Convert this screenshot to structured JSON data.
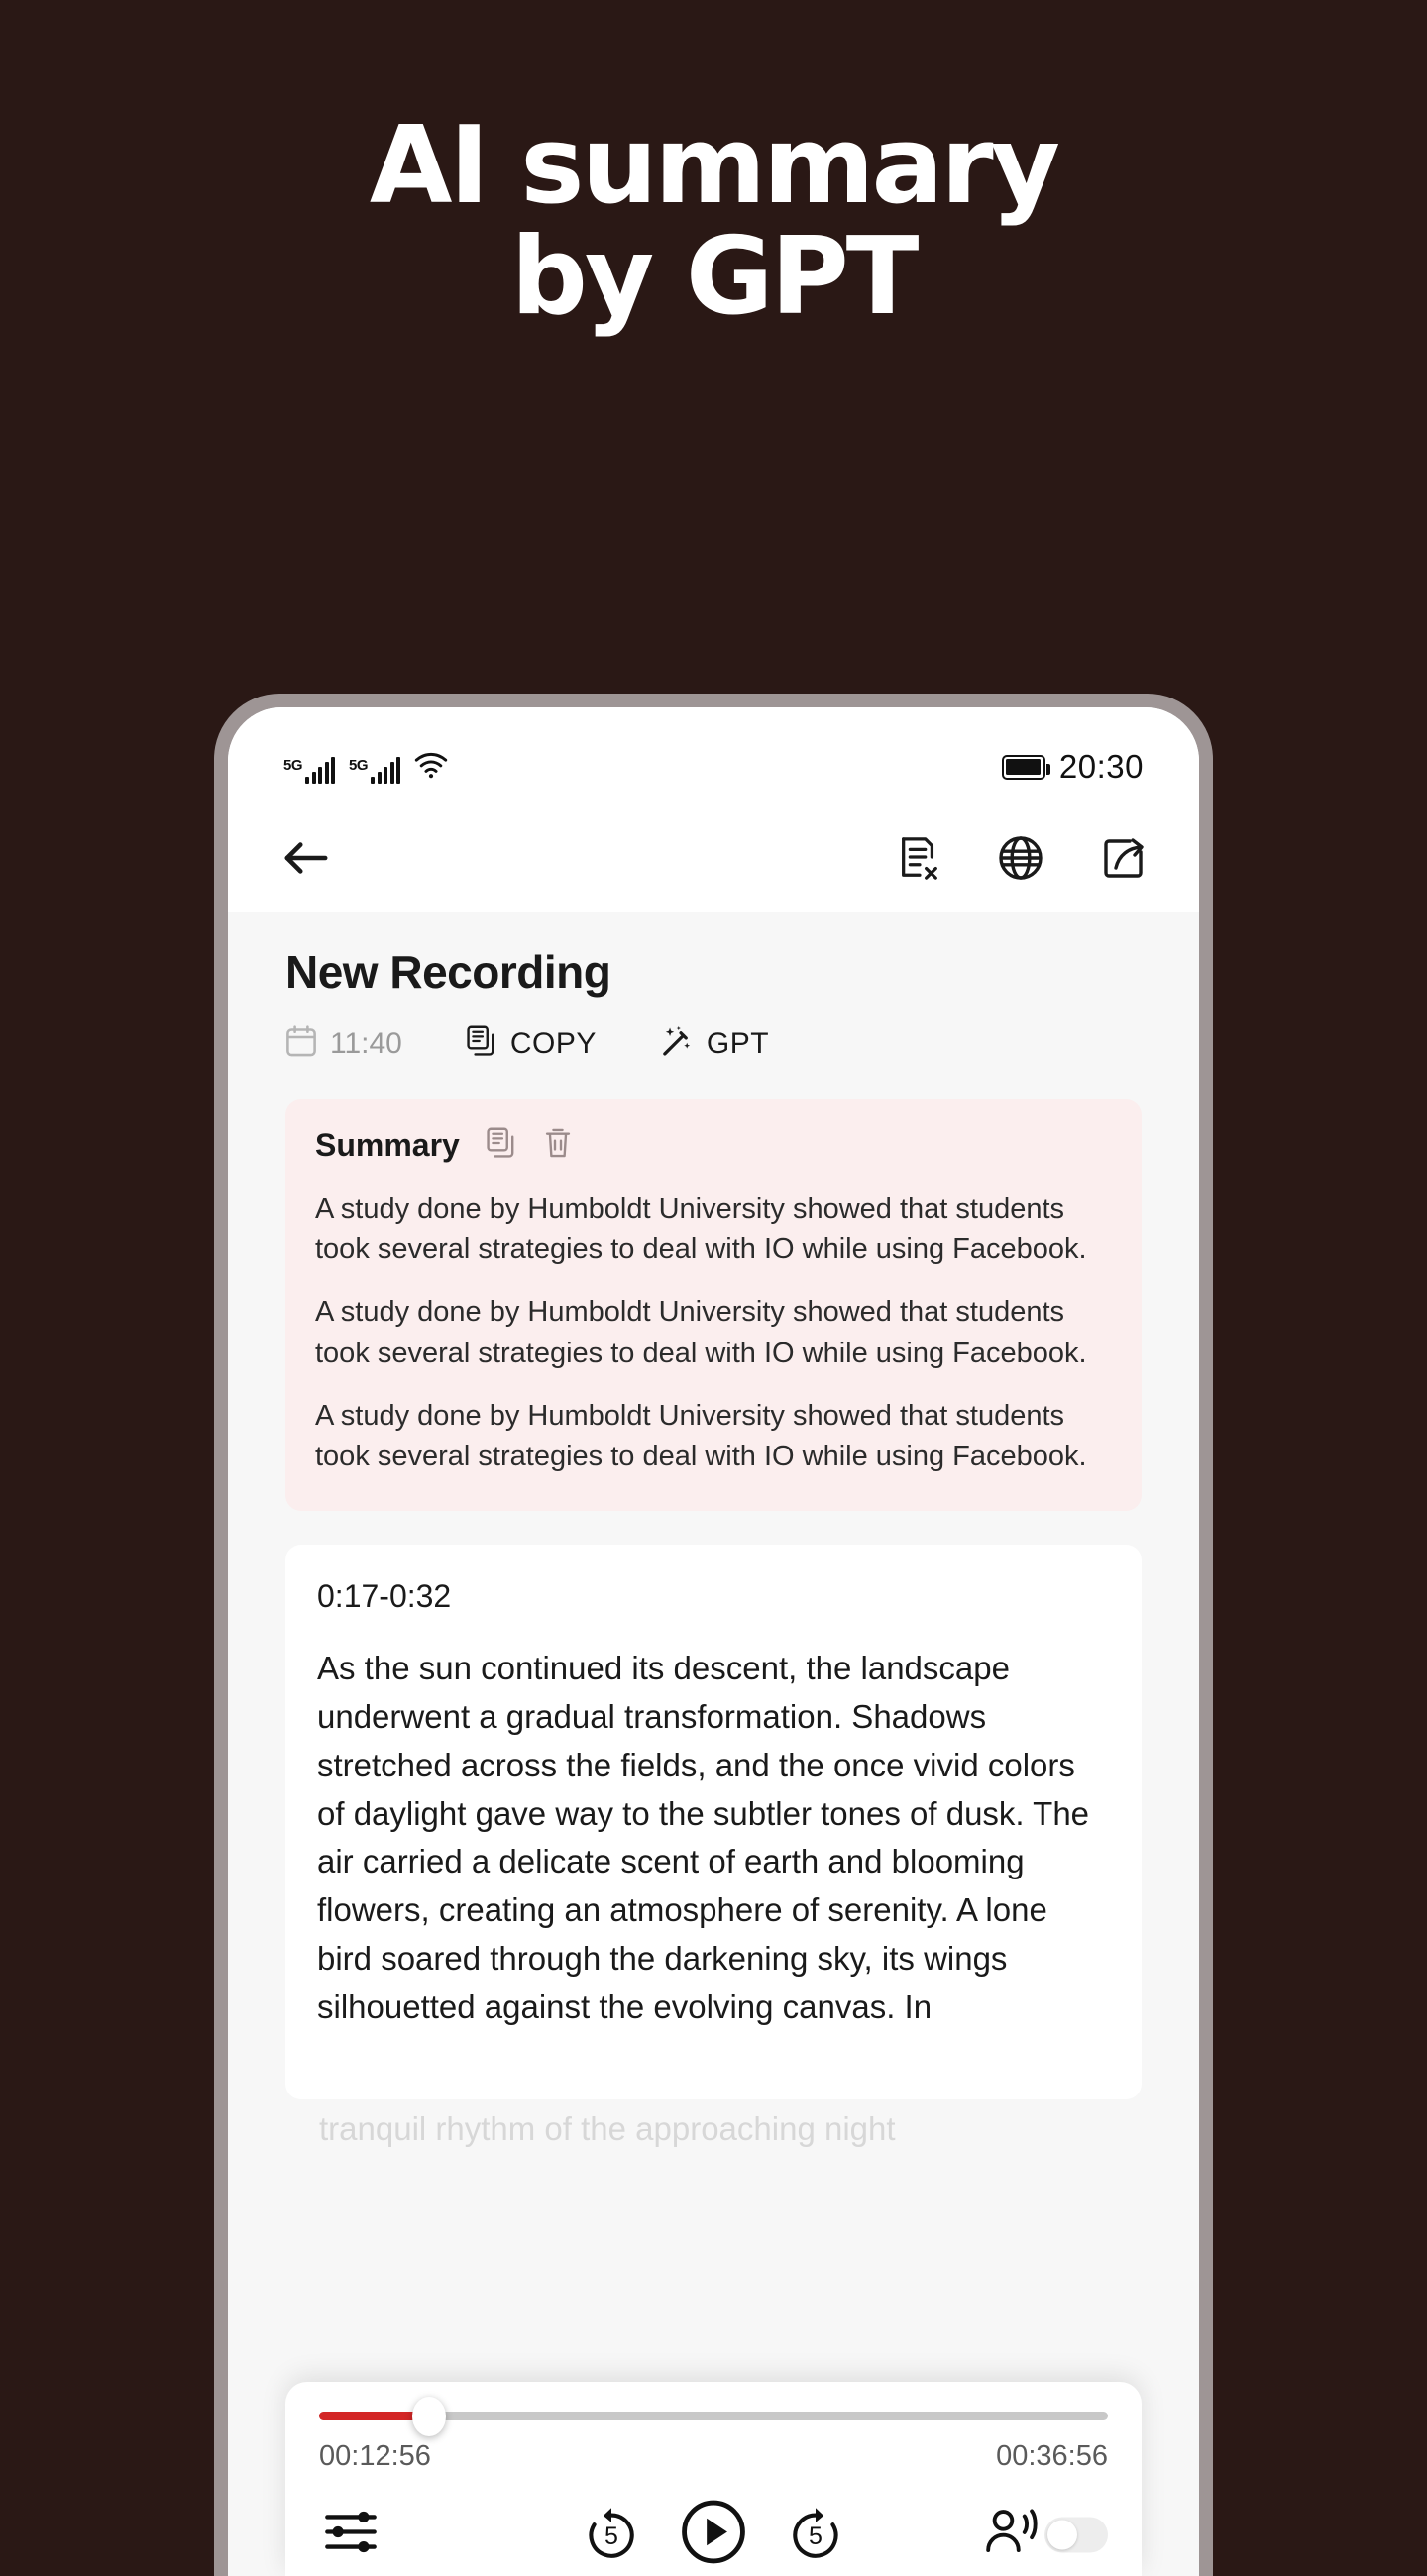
{
  "promo": {
    "line1": "AI summary",
    "line2": "by GPT",
    "background_color": "#2A1815",
    "text_color": "#FFFFFF"
  },
  "phone": {
    "bezel_color": "#9E9595",
    "screen_background": "#FFFFFF",
    "content_background": "#F7F7F7"
  },
  "status_bar": {
    "network_1": "5G",
    "network_2": "5G",
    "wifi_icon": "wifi-icon",
    "battery_icon": "battery-full-icon",
    "time": "20:30"
  },
  "toolbar": {
    "back_icon": "back-arrow-icon",
    "actions": [
      {
        "icon": "document-delete-icon",
        "name": "clear-transcript-button"
      },
      {
        "icon": "globe-icon",
        "name": "translate-button"
      },
      {
        "icon": "share-export-icon",
        "name": "share-button"
      }
    ]
  },
  "note": {
    "title": "New Recording",
    "meta": [
      {
        "icon": "calendar-icon",
        "label": "11:40",
        "name": "recording-time"
      },
      {
        "icon": "copy-icon",
        "label": "COPY",
        "name": "copy-action"
      },
      {
        "icon": "magic-wand-icon",
        "label": "GPT",
        "name": "gpt-action"
      }
    ]
  },
  "summary": {
    "title": "Summary",
    "copy_icon": "copy-icon",
    "delete_icon": "trash-icon",
    "background_color": "#FBEEEE",
    "paragraphs": [
      "A study done by Humboldt University showed that students took several strategies to deal with IO while using Facebook.",
      "A study done by Humboldt University showed that students took several strategies to deal with IO while using Facebook.",
      "A study done by Humboldt University showed that students took several strategies to deal with IO while using Facebook."
    ]
  },
  "transcript": {
    "timestamp": "0:17-0:32",
    "body": "As the sun continued its descent, the landscape underwent a gradual transformation. Shadows stretched across the fields, and the once vivid colors of daylight gave way to the subtler tones of dusk. The air carried a delicate scent of earth and blooming flowers, creating an atmosphere of serenity. A lone bird soared through the darkening sky, its wings silhouetted against the evolving canvas. In",
    "faded_tail": "tranquil rhythm of the approaching night"
  },
  "player": {
    "current_time": "00:12:56",
    "total_time": "00:36:56",
    "progress_percent": 14,
    "progress_color": "#D32626",
    "track_color": "#C8C8C8",
    "controls": [
      {
        "icon": "equalizer-icon",
        "name": "playback-settings-button"
      },
      {
        "icon": "rewind-5-icon",
        "label": "5",
        "name": "rewind-5-button"
      },
      {
        "icon": "play-icon",
        "name": "play-button"
      },
      {
        "icon": "forward-5-icon",
        "label": "5",
        "name": "forward-5-button"
      },
      {
        "icon": "speaker-person-icon",
        "name": "speaker-detection-toggle"
      }
    ]
  }
}
